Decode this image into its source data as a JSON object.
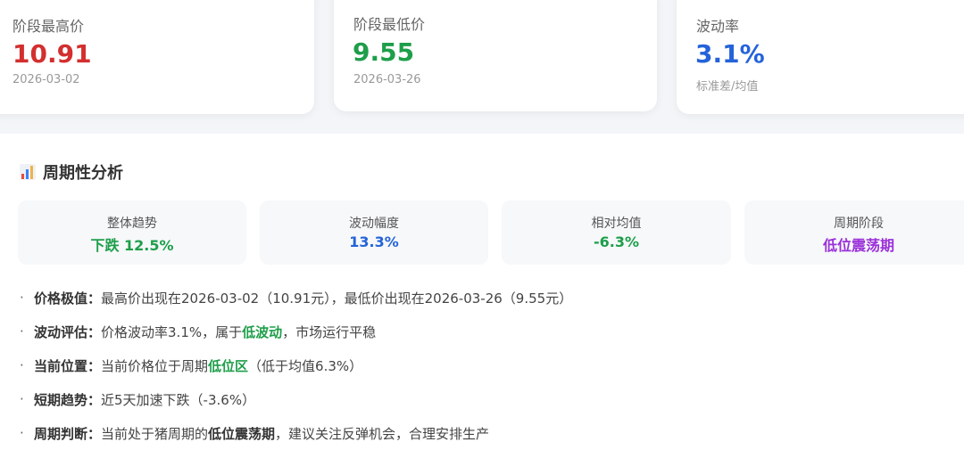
{
  "top_cards": {
    "high": {
      "label": "阶段最高价",
      "value": "10.91",
      "date": "2026-03-02"
    },
    "low": {
      "label": "阶段最低价",
      "value": "9.55",
      "date": "2026-03-26"
    },
    "volatility": {
      "label": "波动率",
      "value": "3.1%",
      "note": "标准差/均值"
    }
  },
  "section": {
    "title": "周期性分析",
    "icon": "bar-chart-icon"
  },
  "stats": {
    "trend": {
      "label": "整体趋势",
      "value": "下跌 12.5%"
    },
    "amplitude": {
      "label": "波动幅度",
      "value": "13.3%"
    },
    "relative": {
      "label": "相对均值",
      "value": "-6.3%"
    },
    "phase": {
      "label": "周期阶段",
      "value": "低位震荡期"
    }
  },
  "bullets": {
    "extreme": {
      "title": "价格极值：",
      "text": "最高价出现在2026-03-02（10.91元），最低价出现在2026-03-26（9.55元）"
    },
    "volatility": {
      "title": "波动评估：",
      "pre": "价格波动率3.1%，属于",
      "highlight": "低波动",
      "post": "，市场运行平稳"
    },
    "position": {
      "title": "当前位置：",
      "pre": "当前价格位于周期",
      "highlight": "低位区",
      "post": "（低于均值6.3%）"
    },
    "short": {
      "title": "短期趋势：",
      "text": "近5天加速下跌（-3.6%）"
    },
    "cycle": {
      "title": "周期判断：",
      "pre": "当前处于猪周期的",
      "highlight": "低位震荡期",
      "post": "，建议关注反弹机会，合理安排生产"
    }
  },
  "colors": {
    "red": "#d32f2f",
    "green": "#1e9e4a",
    "blue": "#2463d9",
    "purple": "#9b30d9"
  }
}
